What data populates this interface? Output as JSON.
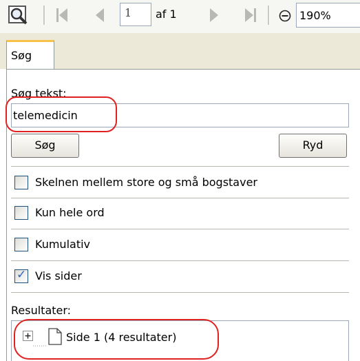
{
  "toolbar": {
    "page_value": "1",
    "page_of": "af 1",
    "zoom": "190%",
    "icons": [
      "find-icon",
      "first-page-icon",
      "prev-page-icon",
      "next-page-icon",
      "last-page-icon",
      "zoom-out-icon"
    ]
  },
  "tabs": [
    {
      "label": "Søg",
      "active": true
    }
  ],
  "search": {
    "label": "Søg tekst:",
    "value": "telemedicin",
    "search_button": "Søg",
    "clear_button": "Ryd"
  },
  "options": [
    {
      "label": "Skelnen mellem store og små bogstaver",
      "checked": false
    },
    {
      "label": "Kun hele ord",
      "checked": false
    },
    {
      "label": "Kumulativ",
      "checked": false
    },
    {
      "label": "Vis sider",
      "checked": true
    }
  ],
  "results": {
    "label": "Resultater:",
    "items": [
      {
        "label": "Side 1 (4 resultater)",
        "expanded": false
      }
    ]
  },
  "colors": {
    "annotation": "#e12020",
    "tab_accent": "#f7c04a",
    "check": "#2f62c4"
  }
}
